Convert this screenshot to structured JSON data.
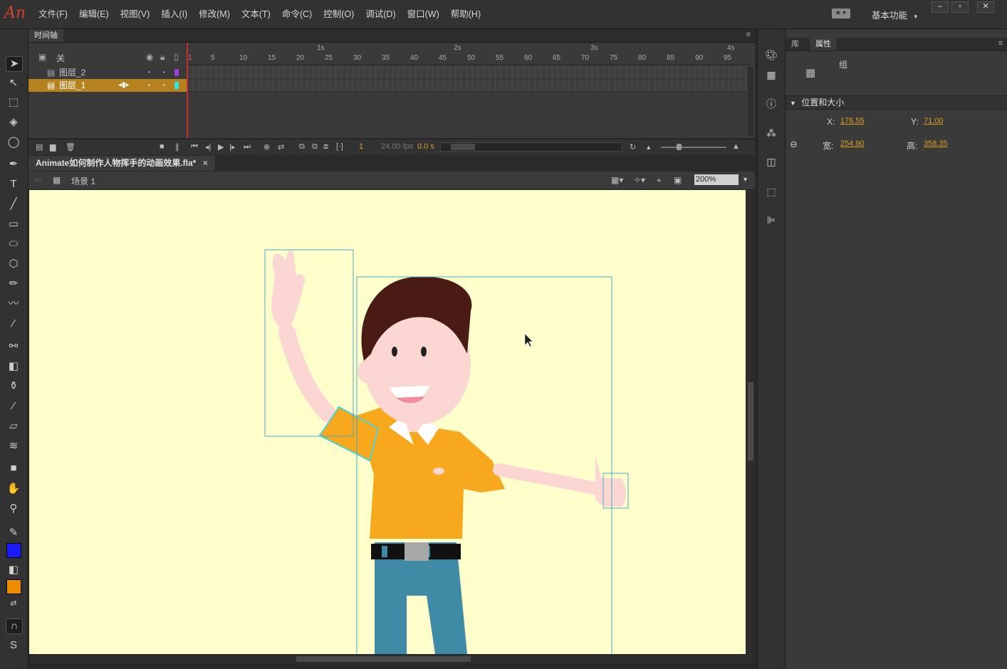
{
  "app": {
    "logo": "An",
    "workspace": "基本功能",
    "workspace_icon": "★✦"
  },
  "menus": [
    "文件(F)",
    "编辑(E)",
    "视图(V)",
    "插入(I)",
    "修改(M)",
    "文本(T)",
    "命令(C)",
    "控制(O)",
    "调试(D)",
    "窗口(W)",
    "帮助(H)"
  ],
  "timeline": {
    "tab_label": "时间轴",
    "header_label": "关",
    "layers": [
      {
        "name": "图层_2",
        "color": "#9b3cdb",
        "active": false
      },
      {
        "name": "图层_1",
        "color": "#2ee5e5",
        "active": true
      }
    ],
    "ruler_seconds": [
      "1s",
      "2s",
      "3s",
      "4s"
    ],
    "ruler_frames": [
      "1",
      "5",
      "10",
      "15",
      "20",
      "25",
      "30",
      "35",
      "40",
      "45",
      "50",
      "55",
      "60",
      "65",
      "70",
      "75",
      "80",
      "85",
      "90",
      "95"
    ],
    "current_frame": "1",
    "fps": "24.00 fps",
    "time": "0.0 s"
  },
  "document": {
    "tab_title": "Animate如何制作人物挥手的动画效果.fla*",
    "close_glyph": "×",
    "scene": "场景 1",
    "zoom": "200%"
  },
  "properties": {
    "tabs": [
      "库",
      "属性"
    ],
    "active_tab": "属性",
    "object_type": "组",
    "section_title": "位置和大小",
    "x_label": "X:",
    "x_value": "176.55",
    "y_label": "Y:",
    "y_value": "71.00",
    "w_label": "宽:",
    "w_value": "254.90",
    "h_label": "高:",
    "h_value": "358.35"
  },
  "colors": {
    "stroke": "#1a1aff",
    "fill": "#f08c00",
    "stage": "#ffffcc",
    "accent": "#e0a020"
  }
}
